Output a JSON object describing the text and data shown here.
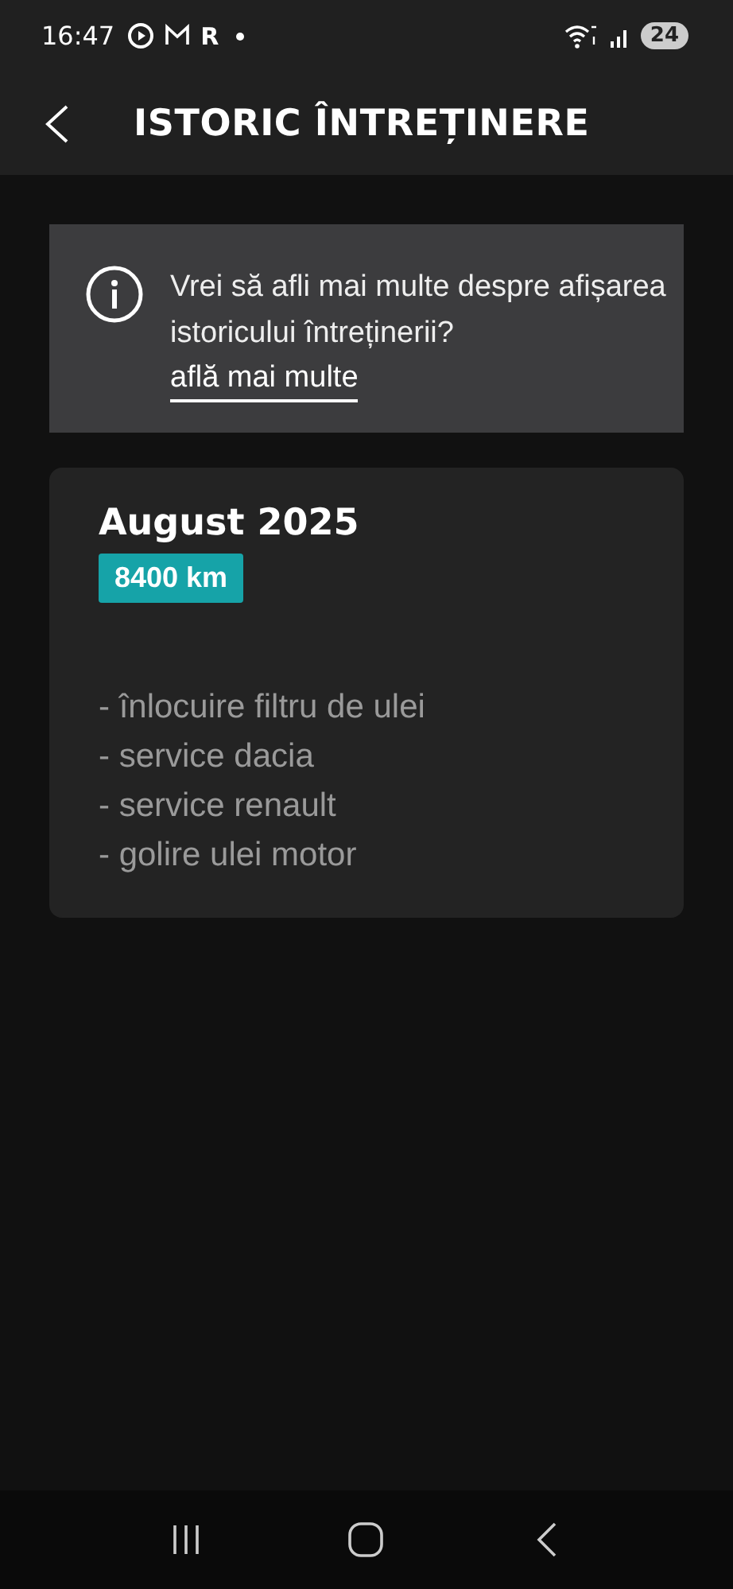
{
  "status_bar": {
    "time": "16:47",
    "notification_letter": "R",
    "battery": "24"
  },
  "header": {
    "title": "ISTORIC ÎNTREȚINERE"
  },
  "info_banner": {
    "text": "Vrei să afli mai multe despre afișarea istoricului întreținerii?",
    "link": "află mai multe"
  },
  "entries": [
    {
      "date": "August 2025",
      "mileage": "8400 km",
      "items": [
        "- înlocuire filtru de ulei",
        "- service dacia",
        "- service renault",
        "- golire ulei motor"
      ]
    }
  ]
}
